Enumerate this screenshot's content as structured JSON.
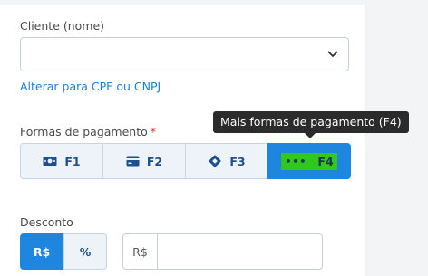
{
  "client": {
    "label": "Cliente (nome)",
    "value": "",
    "alt_link": "Alterar para CPF ou CNPJ"
  },
  "payment": {
    "label": "Formas de pagamento",
    "required_mark": "*",
    "options": [
      {
        "key": "F1",
        "icon": "cash-icon",
        "active": false
      },
      {
        "key": "F2",
        "icon": "card-icon",
        "active": false
      },
      {
        "key": "F3",
        "icon": "pix-icon",
        "active": false
      },
      {
        "key": "F4",
        "icon": "more-dots-icon",
        "dots": "•••",
        "active": true
      }
    ],
    "tooltip": "Mais formas de pagamento (F4)"
  },
  "discount": {
    "label": "Desconto",
    "options": [
      "R$",
      "%"
    ],
    "selected": "R$",
    "input_prefix": "R$",
    "input_value": ""
  },
  "colors": {
    "accent": "#1f86e0",
    "link": "#1e7fd2",
    "required": "#d9352b",
    "highlight": "#31c81e"
  }
}
